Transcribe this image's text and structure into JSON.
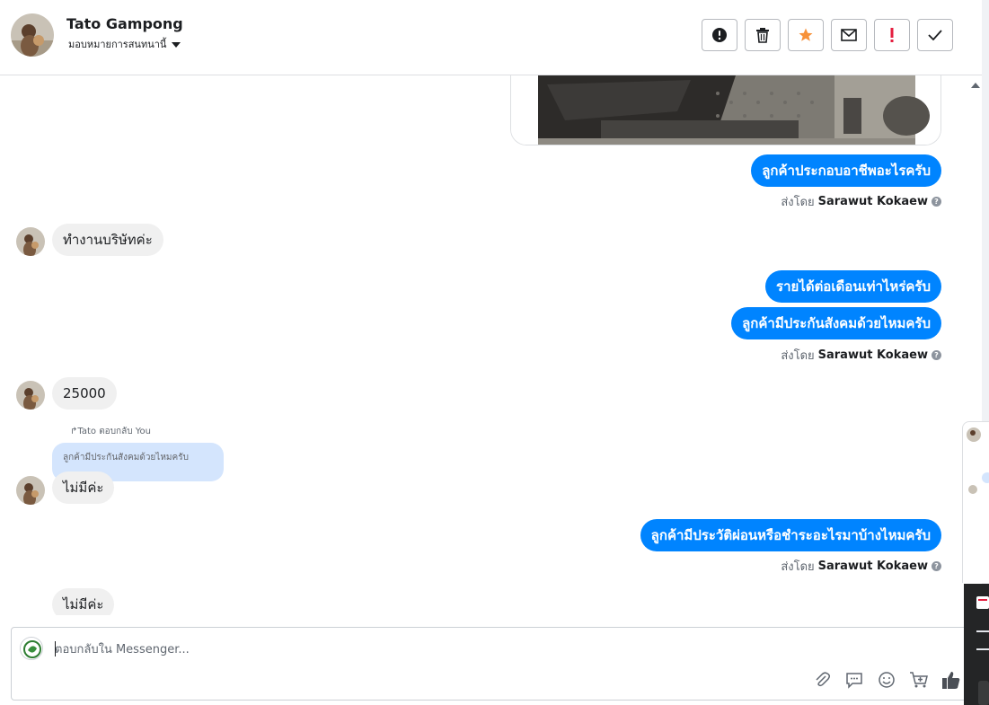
{
  "header": {
    "contact_name": "Tato Gampong",
    "assign_label": "มอบหมายการสนทนานี้",
    "tools": [
      {
        "name": "mark-spam-button",
        "icon": "exclamation-circle-icon"
      },
      {
        "name": "delete-button",
        "icon": "trash-icon"
      },
      {
        "name": "star-button",
        "icon": "star-icon"
      },
      {
        "name": "mark-unread-button",
        "icon": "envelope-icon"
      },
      {
        "name": "follow-up-button",
        "icon": "exclamation-icon"
      },
      {
        "name": "mark-done-button",
        "icon": "check-icon"
      }
    ]
  },
  "messages": {
    "m1": "ลูกค้าประกอบอาชีพอะไรครับ",
    "m2": "ทำงานบริษัทค่ะ",
    "m3": "รายได้ต่อเดือนเท่าไหร่ครับ",
    "m4": "ลูกค้ามีประกันสังคมด้วยไหมครับ",
    "m5": "25000",
    "reply_meta": "Tato ตอบกลับ You",
    "reply_quote": "ลูกค้ามีประกันสังคมด้วยไหมครับ",
    "m6": "ไม่มีค่ะ",
    "m7": "ลูกค้ามีประวัติผ่อนหรือชำระอะไรมาบ้างไหมครับ",
    "m8": "ไม่มีค่ะ"
  },
  "sent_by": {
    "prefix": "ส่งโดย",
    "agent": "Sarawut Kokaew"
  },
  "composer": {
    "placeholder": "ตอบกลับใน Messenger..."
  },
  "colors": {
    "accent": "#0084ff",
    "incoming": "#f0f0f0",
    "star": "#f7923a",
    "alert": "#e41e3f"
  }
}
